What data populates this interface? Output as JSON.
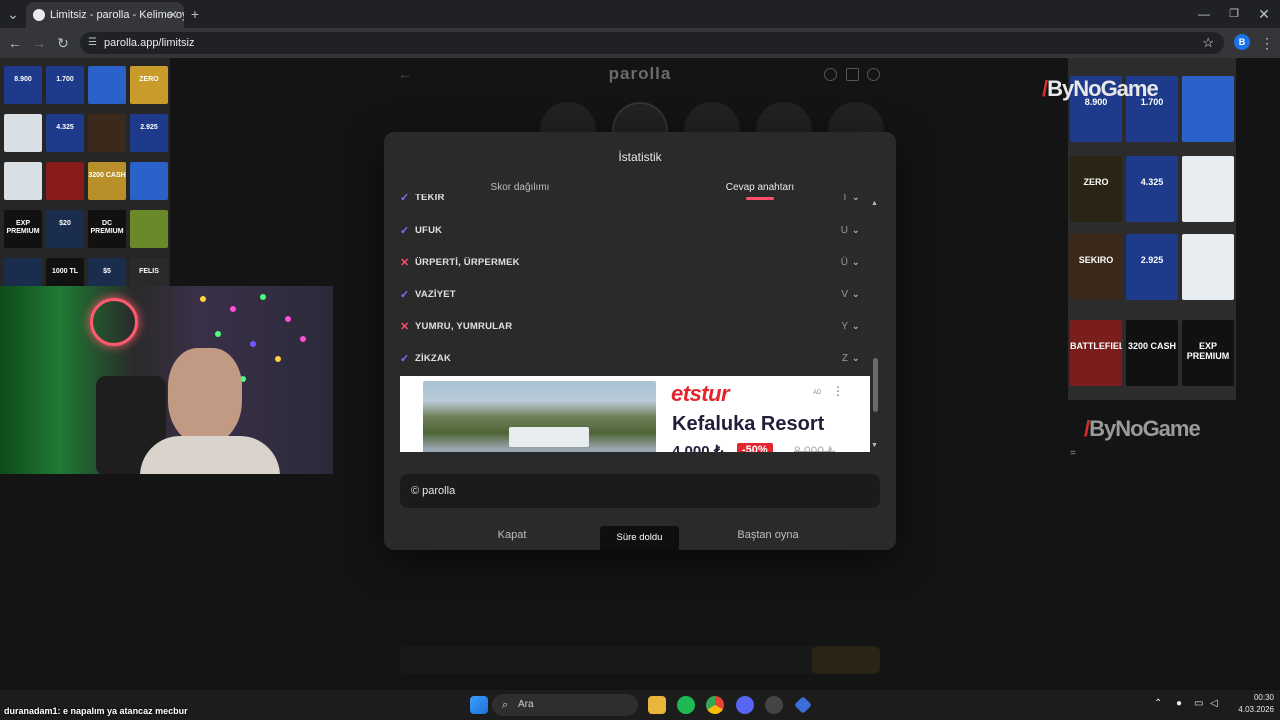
{
  "browser": {
    "tab_title": "Limitsiz - parolla - Kelime oyunu",
    "url": "parolla.app/limitsiz",
    "profile_initial": "B"
  },
  "site": {
    "title": "parolla"
  },
  "modal": {
    "title": "İstatistik",
    "tabs": [
      "Skor dağılımı",
      "Cevap anahtarı"
    ],
    "active_tab": "Cevap anahtarı",
    "answers": [
      {
        "word": "TEKİR",
        "letter": "T",
        "status": "correct"
      },
      {
        "word": "UFUK",
        "letter": "U",
        "status": "correct"
      },
      {
        "word": "ÜRPERTİ, ÜRPERMEK",
        "letter": "Ü",
        "status": "wrong"
      },
      {
        "word": "VAZİYET",
        "letter": "V",
        "status": "correct"
      },
      {
        "word": "YUMRU, YUMRULAR",
        "letter": "Y",
        "status": "wrong"
      },
      {
        "word": "ZİKZAK",
        "letter": "Z",
        "status": "correct"
      }
    ],
    "footer_text": "© parolla",
    "buttons": {
      "close": "Kapat",
      "timeout": "Süre doldu",
      "restart": "Baştan oyna"
    }
  },
  "ad": {
    "brand": "etstur",
    "badge": "AD",
    "headline": "Kefaluka Resort",
    "price": "4.000 ₺",
    "discount": "-50%",
    "old_price": "8.000 ₺"
  },
  "overlay": {
    "brand": "ByNoGame",
    "chat_user": "duranadam1",
    "chat_message": ": e napalım ya atancaz mecbur"
  },
  "left_ads": [
    "8.900",
    "1.700",
    "",
    "ZERO",
    "",
    "4.325",
    "",
    "2.925",
    "",
    "",
    "3200 CASH",
    "",
    "EXP PREMIUM",
    "$20",
    "DC PREMIUM",
    "",
    "",
    "1000 TL",
    "$5",
    "FELIS"
  ],
  "right_ads": [
    "8.900",
    "1.700",
    "",
    "ZERO",
    "4.325",
    "",
    "SEKIRO",
    "2.925",
    "",
    "BATTLEFIELD",
    "3200 CASH",
    "EXP PREMIUM"
  ],
  "taskbar": {
    "search_placeholder": "Ara",
    "time": "00:30",
    "date": "4.03.2026"
  }
}
